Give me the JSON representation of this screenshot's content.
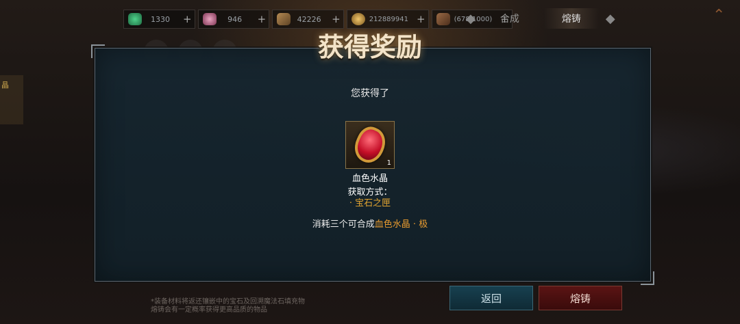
{
  "resources": [
    {
      "icon": "emerald-icon",
      "color": "#2a9a5a",
      "value": "1330",
      "plus": "+"
    },
    {
      "icon": "pink-crystal-icon",
      "color": "#c26a8a",
      "value": "946",
      "plus": "+"
    },
    {
      "icon": "ticket-icon",
      "color": "#8a6a3a",
      "value": "42226",
      "plus": "+"
    },
    {
      "icon": "gold-coin-icon",
      "color": "#b88a3a",
      "value": "212889941",
      "plus": "+"
    },
    {
      "icon": "material-icon",
      "color": "#8a5a3a",
      "value": "(678/1000)",
      "plus": "+"
    }
  ],
  "tabs": {
    "synthesize": "合成",
    "forge": "熔铸"
  },
  "side_label": "晶",
  "dialog": {
    "title": "获得奖励",
    "subtitle": "您获得了",
    "item": {
      "name": "血色水晶",
      "count": "1"
    },
    "acquire_label": "获取方式：",
    "acquire_source": "·   宝石之匣",
    "note_prefix": "消耗三个可合成",
    "note_highlight": "血色水晶 · 极"
  },
  "footnote": [
    "*装备材料将返还镶嵌中的宝石及回溯魔法石填充物",
    "熔铸会有一定概率获得更高品质的物品"
  ],
  "buttons": {
    "back": "返回",
    "forge": "熔铸"
  },
  "colors": {
    "accent_orange": "#e89b2f",
    "dialog_bg": "#162630",
    "back_button": "#17404f",
    "forge_button": "#5a1414"
  }
}
